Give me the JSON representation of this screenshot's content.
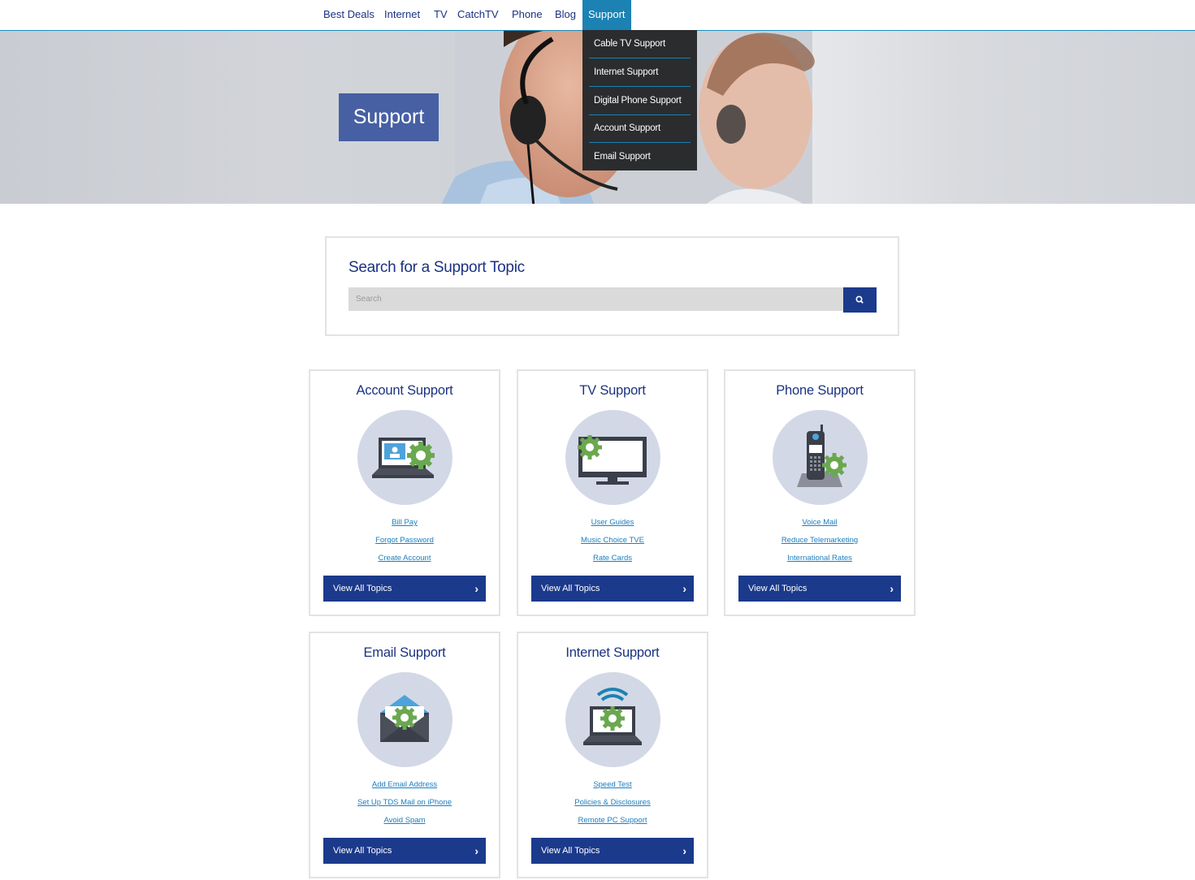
{
  "nav": {
    "items": [
      {
        "label": "Best Deals"
      },
      {
        "label": "Internet"
      },
      {
        "label": "TV"
      },
      {
        "label": "CatchTV"
      },
      {
        "label": "Phone"
      },
      {
        "label": "Blog"
      },
      {
        "label": "Support",
        "active": true
      }
    ]
  },
  "dropdown": {
    "items": [
      {
        "label": "Cable TV Support"
      },
      {
        "label": "Internet Support"
      },
      {
        "label": "Digital Phone Support"
      },
      {
        "label": "Account Support"
      },
      {
        "label": "Email Support"
      }
    ]
  },
  "hero": {
    "title": "Support"
  },
  "search": {
    "title": "Search for a Support Topic",
    "placeholder": "Search",
    "button_icon": "search-icon"
  },
  "cards": [
    {
      "title": "Account Support",
      "icon": "laptop-gear-icon",
      "links": [
        "Bill Pay",
        "Forgot Password",
        "Create Account"
      ],
      "button": "View All Topics"
    },
    {
      "title": "TV Support",
      "icon": "tv-gear-icon",
      "links": [
        "User Guides",
        "Music Choice TVE",
        "Rate Cards"
      ],
      "button": "View All Topics"
    },
    {
      "title": "Phone Support",
      "icon": "phone-gear-icon",
      "links": [
        "Voice Mail",
        "Reduce Telemarketing",
        "International Rates"
      ],
      "button": "View All Topics"
    },
    {
      "title": "Email Support",
      "icon": "envelope-gear-icon",
      "links": [
        "Add Email Address",
        "Set Up TDS Mail on iPhone",
        "Avoid Spam"
      ],
      "button": "View All Topics"
    },
    {
      "title": "Internet Support",
      "icon": "wifi-laptop-gear-icon",
      "links": [
        "Speed Test",
        "Policies & Disclosures",
        "Remote PC Support"
      ],
      "button": "View All Topics"
    }
  ],
  "colors": {
    "brand_navy": "#1b3a8c",
    "accent_blue": "#1b82b3",
    "gear_green": "#6aa84f",
    "icon_circle": "#d3d8e6"
  }
}
